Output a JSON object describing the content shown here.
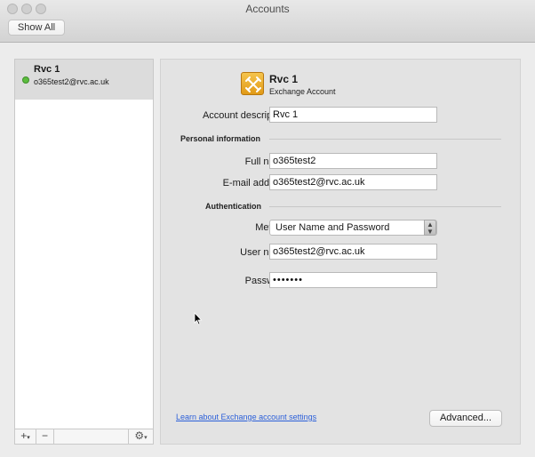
{
  "window": {
    "title": "Accounts"
  },
  "toolbar": {
    "show_all_label": "Show All"
  },
  "sidebar": {
    "accounts": [
      {
        "name": "Rvc 1",
        "email": "o365test2@rvc.ac.uk",
        "status_color": "#5cbd3e"
      }
    ],
    "add_label": "+",
    "remove_label": "−",
    "gear_icon": "gear-icon"
  },
  "account": {
    "header_name": "Rvc 1",
    "header_type": "Exchange Account",
    "icon": "exchange-icon",
    "description_label": "Account description:",
    "description_value": "Rvc 1",
    "personal_section": "Personal information",
    "full_name_label": "Full name:",
    "full_name_value": "o365test2",
    "email_label": "E-mail address:",
    "email_value": "o365test2@rvc.ac.uk",
    "auth_section": "Authentication",
    "method_label": "Method:",
    "method_value": "User Name and Password",
    "username_label": "User name:",
    "username_value": "o365test2@rvc.ac.uk",
    "password_label": "Password:",
    "password_value": "•••••••",
    "learn_link": "Learn about Exchange account settings",
    "advanced_label": "Advanced..."
  }
}
